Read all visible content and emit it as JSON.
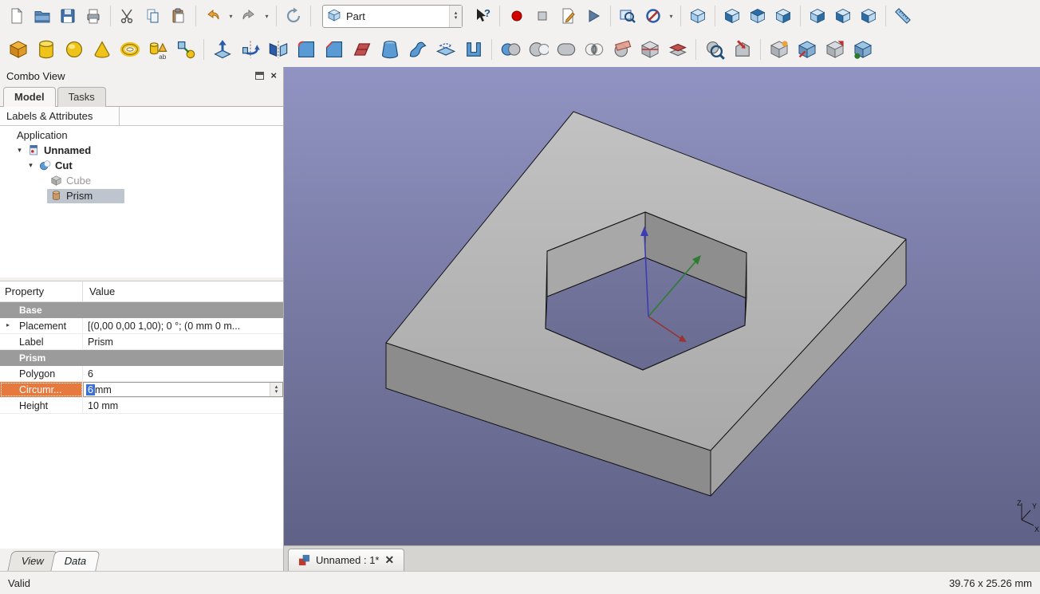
{
  "window": {
    "status_left": "Valid",
    "status_right": "39.76 x 25.26 mm"
  },
  "workbench": {
    "selected": "Part"
  },
  "doc_tab": {
    "label": "Unnamed : 1*"
  },
  "combo_view": {
    "title": "Combo View",
    "tabs": [
      {
        "label": "Model",
        "active": true
      },
      {
        "label": "Tasks",
        "active": false
      }
    ],
    "tree_header": "Labels & Attributes",
    "tree": [
      {
        "label": "Application",
        "depth": 0,
        "icon": "none"
      },
      {
        "label": "Unnamed",
        "depth": 1,
        "icon": "doc",
        "bold": true,
        "expander": true
      },
      {
        "label": "Cut",
        "depth": 2,
        "icon": "cut",
        "bold": true,
        "expander": true
      },
      {
        "label": "Cube",
        "depth": 3,
        "icon": "cube-gray",
        "gray": true
      },
      {
        "label": "Prism",
        "depth": 3,
        "icon": "prism",
        "selected": true
      }
    ],
    "property_view": {
      "columns": [
        "Property",
        "Value"
      ],
      "rows": [
        {
          "type": "group",
          "label": "Base"
        },
        {
          "type": "row",
          "name": "Placement",
          "value": "[(0,00 0,00 1,00); 0 °; (0 mm  0 m...",
          "expander": true
        },
        {
          "type": "row",
          "name": "Label",
          "value": "Prism"
        },
        {
          "type": "group",
          "label": "Prism"
        },
        {
          "type": "row",
          "name": "Polygon",
          "value": "6"
        },
        {
          "type": "row",
          "name": "Circumr...",
          "selected": true,
          "editor": {
            "sel": "6",
            "rest": " mm"
          }
        },
        {
          "type": "row",
          "name": "Height",
          "value": "10 mm"
        }
      ]
    },
    "bottom_tabs": [
      {
        "label": "View",
        "active": false
      },
      {
        "label": "Data",
        "active": true
      }
    ]
  },
  "colors": {
    "viewport_top": "#9193c2",
    "viewport_bottom": "#5f6186",
    "selection_orange": "#e5793e",
    "selection_blue": "#3a6fd8",
    "tree_selection": "#bfc5cf"
  },
  "toolbars": {
    "row1": [
      {
        "name": "new-document-button",
        "icon": "page"
      },
      {
        "name": "open-button",
        "icon": "folder"
      },
      {
        "name": "save-button",
        "icon": "save"
      },
      {
        "name": "print-button",
        "icon": "print"
      },
      {
        "type": "sep"
      },
      {
        "name": "cut-button",
        "icon": "scissors"
      },
      {
        "name": "copy-button",
        "icon": "copy"
      },
      {
        "name": "paste-button",
        "icon": "paste"
      },
      {
        "type": "sep"
      },
      {
        "name": "undo-button",
        "icon": "undo",
        "dropdown": true
      },
      {
        "name": "redo-button",
        "icon": "redo",
        "dropdown": true
      },
      {
        "type": "sep"
      },
      {
        "name": "refresh-button",
        "icon": "refresh"
      },
      {
        "type": "sep"
      },
      {
        "type": "combo",
        "name": "workbench-selector"
      },
      {
        "name": "whats-this-button",
        "icon": "whatsthis"
      },
      {
        "type": "sep"
      },
      {
        "name": "macro-record-button",
        "icon": "record"
      },
      {
        "name": "macro-stop-button",
        "icon": "stop"
      },
      {
        "name": "macro-edit-button",
        "icon": "macroedit"
      },
      {
        "name": "macro-execute-button",
        "icon": "play"
      },
      {
        "type": "sep"
      },
      {
        "name": "box-zoom-button",
        "icon": "boxzoom"
      },
      {
        "name": "clipping-plane-button",
        "icon": "clip",
        "dropdown": true
      },
      {
        "type": "sep"
      },
      {
        "name": "view-axonometric-button",
        "icon": "vcube-axo"
      },
      {
        "type": "sep"
      },
      {
        "name": "view-front-button",
        "icon": "vcube-front"
      },
      {
        "name": "view-top-button",
        "icon": "vcube-top"
      },
      {
        "name": "view-right-button",
        "icon": "vcube-right"
      },
      {
        "type": "sep"
      },
      {
        "name": "view-rear-button",
        "icon": "vcube-rear"
      },
      {
        "name": "view-bottom-button",
        "icon": "vcube-bottom"
      },
      {
        "name": "view-left-button",
        "icon": "vcube-left"
      },
      {
        "type": "sep"
      },
      {
        "name": "measure-button",
        "icon": "measure"
      }
    ],
    "row2": [
      {
        "name": "part-box-button",
        "icon": "pbox"
      },
      {
        "name": "part-cylinder-button",
        "icon": "pcyl"
      },
      {
        "name": "part-sphere-button",
        "icon": "psph"
      },
      {
        "name": "part-cone-button",
        "icon": "pcone"
      },
      {
        "name": "part-torus-button",
        "icon": "ptorus"
      },
      {
        "name": "part-primitives-button",
        "icon": "pprims"
      },
      {
        "name": "part-shape-builder-button",
        "icon": "pbuilder"
      },
      {
        "type": "sep"
      },
      {
        "name": "part-extrude-button",
        "icon": "extrude"
      },
      {
        "name": "part-revolve-button",
        "icon": "revolve"
      },
      {
        "name": "part-mirror-button",
        "icon": "mirror"
      },
      {
        "name": "part-fillet-button",
        "icon": "fillet"
      },
      {
        "name": "part-chamfer-button",
        "icon": "chamfer"
      },
      {
        "name": "part-ruled-surface-button",
        "icon": "ruled"
      },
      {
        "name": "part-loft-button",
        "icon": "loft"
      },
      {
        "name": "part-sweep-button",
        "icon": "sweep"
      },
      {
        "name": "part-offset-button",
        "icon": "offset"
      },
      {
        "name": "part-thickness-button",
        "icon": "thickness"
      },
      {
        "type": "sep"
      },
      {
        "name": "part-boolean-button",
        "icon": "boolean"
      },
      {
        "name": "part-cut-button",
        "icon": "bcut"
      },
      {
        "name": "part-union-button",
        "icon": "bunion"
      },
      {
        "name": "part-common-button",
        "icon": "bcommon"
      },
      {
        "name": "part-section-button",
        "icon": "section"
      },
      {
        "name": "part-cross-sections-button",
        "icon": "crosssec"
      },
      {
        "name": "part-3d-offset-button",
        "icon": "offset3d"
      },
      {
        "type": "sep"
      },
      {
        "name": "part-check-geometry-button",
        "icon": "checkgeo"
      },
      {
        "name": "part-defeaturing-button",
        "icon": "defeature"
      },
      {
        "type": "sep"
      },
      {
        "name": "part-simple-copy-button",
        "icon": "copy1"
      },
      {
        "name": "part-transformed-copy-button",
        "icon": "copy2"
      },
      {
        "name": "part-element-copy-button",
        "icon": "copy3"
      },
      {
        "name": "part-refine-shape-button",
        "icon": "refine"
      }
    ]
  }
}
